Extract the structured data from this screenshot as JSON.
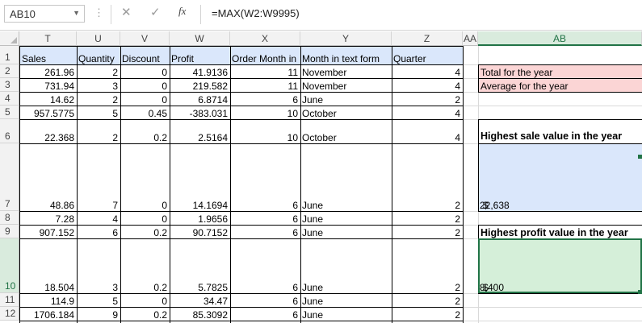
{
  "name_box": "AB10",
  "formula": "=MAX(W2:W9995)",
  "fx_label": "fx",
  "columns": [
    "T",
    "U",
    "V",
    "W",
    "X",
    "Y",
    "Z",
    "AA",
    "AB"
  ],
  "rows": [
    "1",
    "2",
    "3",
    "4",
    "5",
    "6",
    "7",
    "8",
    "9",
    "10",
    "11",
    "12"
  ],
  "headers": {
    "sales": "Sales",
    "quantity": "Quantity",
    "discount": "Discount",
    "profit": "Profit",
    "order_month": "Order Month in",
    "month_text": "Month in text form",
    "quarter": "Quarter"
  },
  "data": [
    {
      "sales": "261.96",
      "qty": "2",
      "disc": "0",
      "profit": "41.9136",
      "om": "11",
      "mt": "November",
      "q": "4"
    },
    {
      "sales": "731.94",
      "qty": "3",
      "disc": "0",
      "profit": "219.582",
      "om": "11",
      "mt": "November",
      "q": "4"
    },
    {
      "sales": "14.62",
      "qty": "2",
      "disc": "0",
      "profit": "6.8714",
      "om": "6",
      "mt": "June",
      "q": "2"
    },
    {
      "sales": "957.5775",
      "qty": "5",
      "disc": "0.45",
      "profit": "-383.031",
      "om": "10",
      "mt": "October",
      "q": "4"
    },
    {
      "sales": "22.368",
      "qty": "2",
      "disc": "0.2",
      "profit": "2.5164",
      "om": "10",
      "mt": "October",
      "q": "4"
    },
    {
      "sales": "48.86",
      "qty": "7",
      "disc": "0",
      "profit": "14.1694",
      "om": "6",
      "mt": "June",
      "q": "2"
    },
    {
      "sales": "7.28",
      "qty": "4",
      "disc": "0",
      "profit": "1.9656",
      "om": "6",
      "mt": "June",
      "q": "2"
    },
    {
      "sales": "907.152",
      "qty": "6",
      "disc": "0.2",
      "profit": "90.7152",
      "om": "6",
      "mt": "June",
      "q": "2"
    },
    {
      "sales": "18.504",
      "qty": "3",
      "disc": "0.2",
      "profit": "5.7825",
      "om": "6",
      "mt": "June",
      "q": "2"
    },
    {
      "sales": "114.9",
      "qty": "5",
      "disc": "0",
      "profit": "34.47",
      "om": "6",
      "mt": "June",
      "q": "2"
    },
    {
      "sales": "1706.184",
      "qty": "9",
      "disc": "0.2",
      "profit": "85.3092",
      "om": "6",
      "mt": "June",
      "q": "2"
    }
  ],
  "summary": {
    "total_label": "Total for the year",
    "average_label": "Average for the year",
    "highest_sale_label": "Highest sale value in the year",
    "highest_sale_currency": "$",
    "highest_sale_value": "22,638",
    "highest_profit_label": "Highest profit value in the year",
    "highest_profit_currency": "$",
    "highest_profit_value": "8,400"
  },
  "colors": {
    "pink": "#fbd5d5",
    "blue": "#dae7fb",
    "green": "#d5efd9",
    "header_blue": "#dae7fb",
    "selected_green": "#217346"
  }
}
